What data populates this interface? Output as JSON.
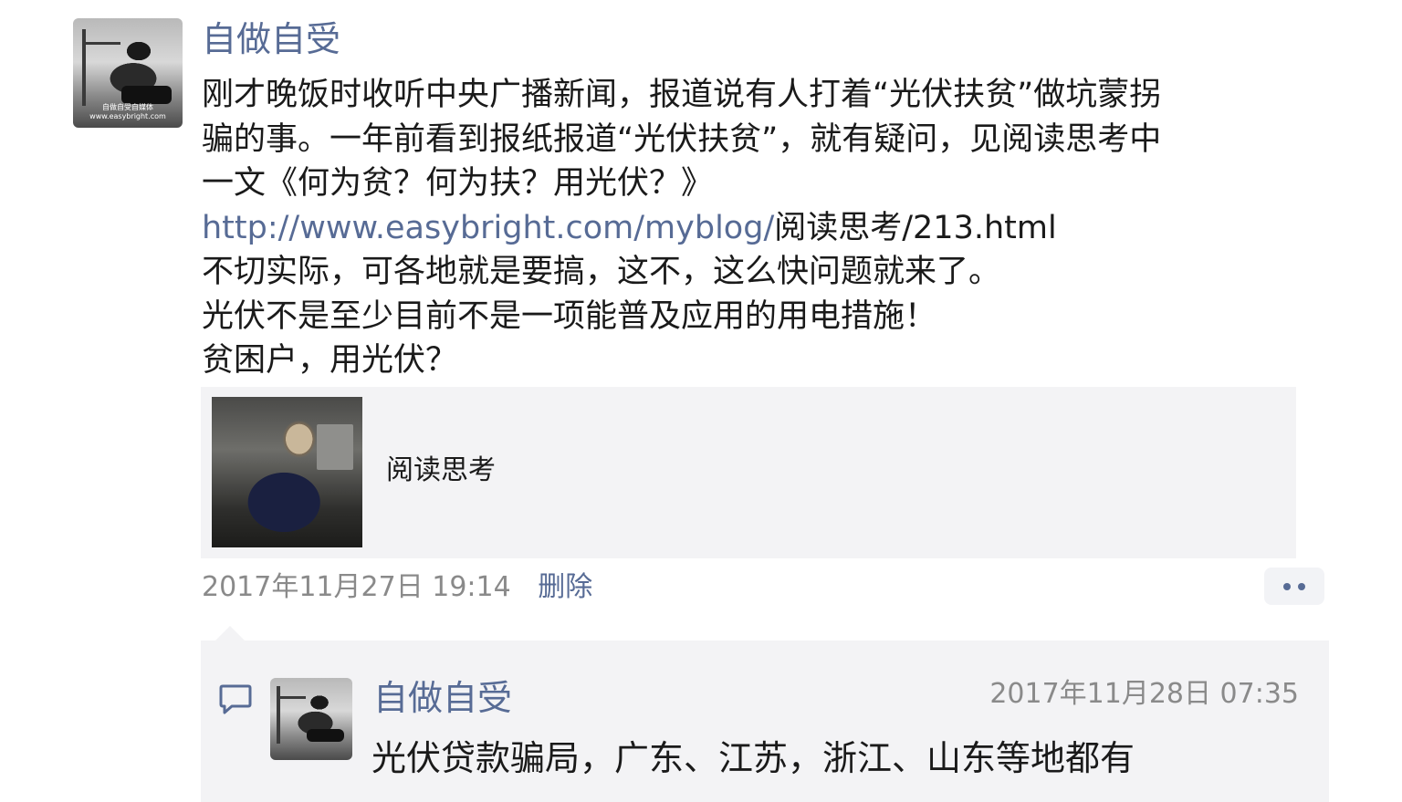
{
  "post": {
    "author": "自做自受",
    "lines": [
      "刚才晚饭时收听中央广播新闻，报道说有人打着“光伏扶贫”做坑蒙拐",
      "骗的事。一年前看到报纸报道“光伏扶贫”，就有疑问，见阅读思考中",
      "一文《何为贫？何为扶？用光伏？》"
    ],
    "link_prefix": "http://www.easybright.com/myblog/",
    "link_suffix": "阅读思考/213.html",
    "lines_after": [
      "不切实际，可各地就是要搞，这不，这么快问题就来了。",
      "光伏不是至少目前不是一项能普及应用的用电措施！",
      "贫困户，用光伏？"
    ],
    "share_card": {
      "title": "阅读思考",
      "thumb": "photo-thumbnail"
    },
    "timestamp": "2017年11月27日 19:14",
    "delete_label": "删除",
    "avatar_caption_1": "自做自受自媒体",
    "avatar_caption_2": "www.easybright.com"
  },
  "comment": {
    "author": "自做自受",
    "time": "2017年11月28日 07:35",
    "text": "光伏贷款骗局，广东、江苏，浙江、山东等地都有",
    "icon": "comment-bubble-icon"
  },
  "colors": {
    "link": "#576b95",
    "meta": "#8a8a8a",
    "panel": "#f3f3f5"
  }
}
